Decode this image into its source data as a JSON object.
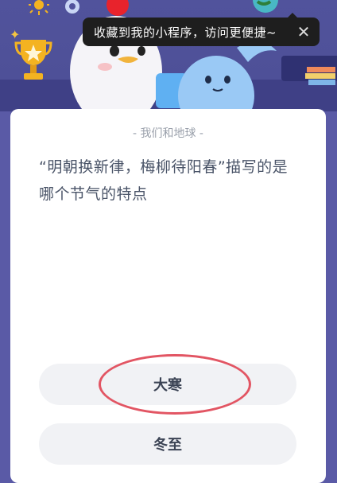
{
  "toast": {
    "text": "收藏到我的小程序，访问更便捷~",
    "close": "✕"
  },
  "card": {
    "category": "- 我们和地球 -",
    "question": "“明朝换新律，梅柳待阳春”描写的是哪个节气的特点",
    "options": [
      {
        "label": "大寒"
      },
      {
        "label": "冬至"
      }
    ]
  },
  "colors": {
    "card_bg": "#ffffff",
    "option_bg": "#f1f2f5",
    "highlight_circle": "#e25563",
    "banner_bg": "#51539c"
  }
}
